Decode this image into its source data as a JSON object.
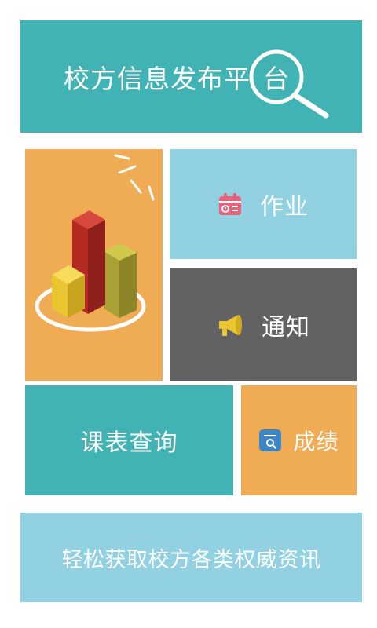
{
  "banner": {
    "title": "校方信息发布平",
    "title_last_char": "台",
    "icon": "magnifier-icon"
  },
  "tiles": {
    "chart": {
      "icon": "bar-chart-icon",
      "colors": {
        "bg": "#f0ac55",
        "tall_bar": "#b52a23",
        "left_bar": "#e9c530",
        "right_bar": "#a9a133",
        "ring": "#ffffff"
      }
    },
    "homework": {
      "label": "作业",
      "icon": "calendar-icon",
      "icon_color": "#e8607a",
      "bg": "#92d1e2"
    },
    "notice": {
      "label": "通知",
      "icon": "megaphone-icon",
      "icon_color": "#e9c530",
      "bg": "#626262"
    },
    "schedule": {
      "label": "课表查询",
      "bg": "#42b3b4"
    },
    "grades": {
      "label": "成绩",
      "icon": "report-search-icon",
      "icon_color": "#3d86c6",
      "bg": "#f0ac55"
    }
  },
  "footer": {
    "tagline": "轻松获取校方各类权威资讯",
    "bg": "#92d1e2"
  },
  "accent": "#42b3b4"
}
